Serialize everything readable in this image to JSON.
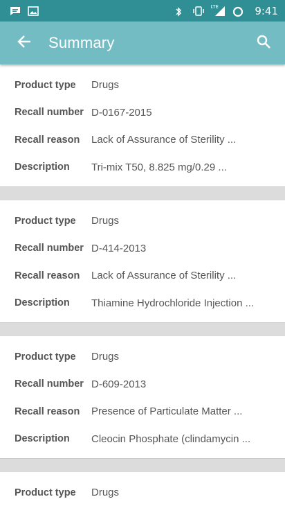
{
  "status_bar": {
    "time": "9:41",
    "left_icons": [
      "message-icon",
      "image-icon"
    ],
    "right_icons": [
      "bluetooth-icon",
      "vibrate-icon",
      "lte-signal-icon",
      "sync-icon"
    ],
    "lte_label": "LTE"
  },
  "app_bar": {
    "title": "Summary",
    "back_icon": "arrow-back-icon",
    "search_icon": "search-icon"
  },
  "labels": {
    "product_type": "Product type",
    "recall_number": "Recall number",
    "recall_reason": "Recall reason",
    "description": "Description"
  },
  "recalls": [
    {
      "product_type": "Drugs",
      "recall_number": "D-0167-2015",
      "recall_reason": "Lack of Assurance of Sterility ...",
      "description": "Tri-mix T50, 8.825 mg/0.29 ..."
    },
    {
      "product_type": "Drugs",
      "recall_number": "D-414-2013",
      "recall_reason": "Lack of Assurance of Sterility ...",
      "description": "Thiamine Hydrochloride Injection ..."
    },
    {
      "product_type": "Drugs",
      "recall_number": "D-609-2013",
      "recall_reason": "Presence of Particulate Matter ...",
      "description": "Cleocin Phosphate (clindamycin ..."
    },
    {
      "product_type": "Drugs"
    }
  ],
  "colors": {
    "status_bar": "#2f8f94",
    "app_bar": "#73bcc4",
    "background": "#dcdcdc",
    "card": "#ffffff"
  }
}
